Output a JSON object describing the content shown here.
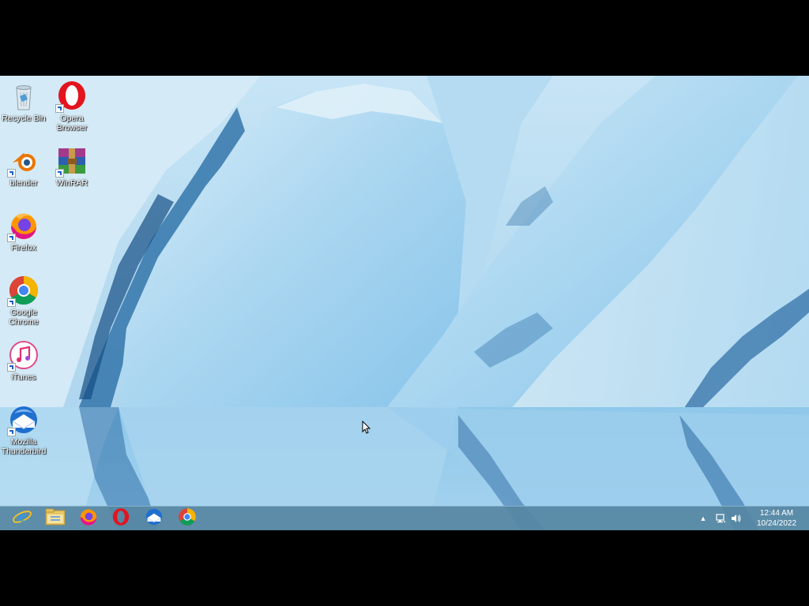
{
  "desktop": {
    "icons": [
      {
        "label": "Recycle Bin",
        "icon": "recycle-bin-icon"
      },
      {
        "label": "Opera Browser",
        "icon": "opera-icon"
      },
      {
        "label": "blender",
        "icon": "blender-icon"
      },
      {
        "label": "WinRAR",
        "icon": "winrar-icon"
      },
      {
        "label": "Firefox",
        "icon": "firefox-icon"
      },
      {
        "label": "Google Chrome",
        "icon": "chrome-icon"
      },
      {
        "label": "iTunes",
        "icon": "itunes-icon"
      },
      {
        "label": "Mozilla Thunderbird",
        "icon": "thunderbird-icon"
      }
    ]
  },
  "taskbar": {
    "pinned": [
      {
        "icon": "internet-explorer-icon"
      },
      {
        "icon": "file-explorer-icon"
      },
      {
        "icon": "firefox-icon"
      },
      {
        "icon": "opera-icon"
      },
      {
        "icon": "thunderbird-icon"
      },
      {
        "icon": "chrome-icon"
      }
    ],
    "tray": {
      "show_hidden": "▲",
      "icons": [
        "network-icon",
        "volume-icon"
      ]
    },
    "clock": {
      "time": "12:44 AM",
      "date": "10/24/2022"
    }
  },
  "colors": {
    "taskbar": "#5686a3",
    "wallpaper_ice": "#a8d4ef",
    "wallpaper_dark": "#1f5f95"
  }
}
